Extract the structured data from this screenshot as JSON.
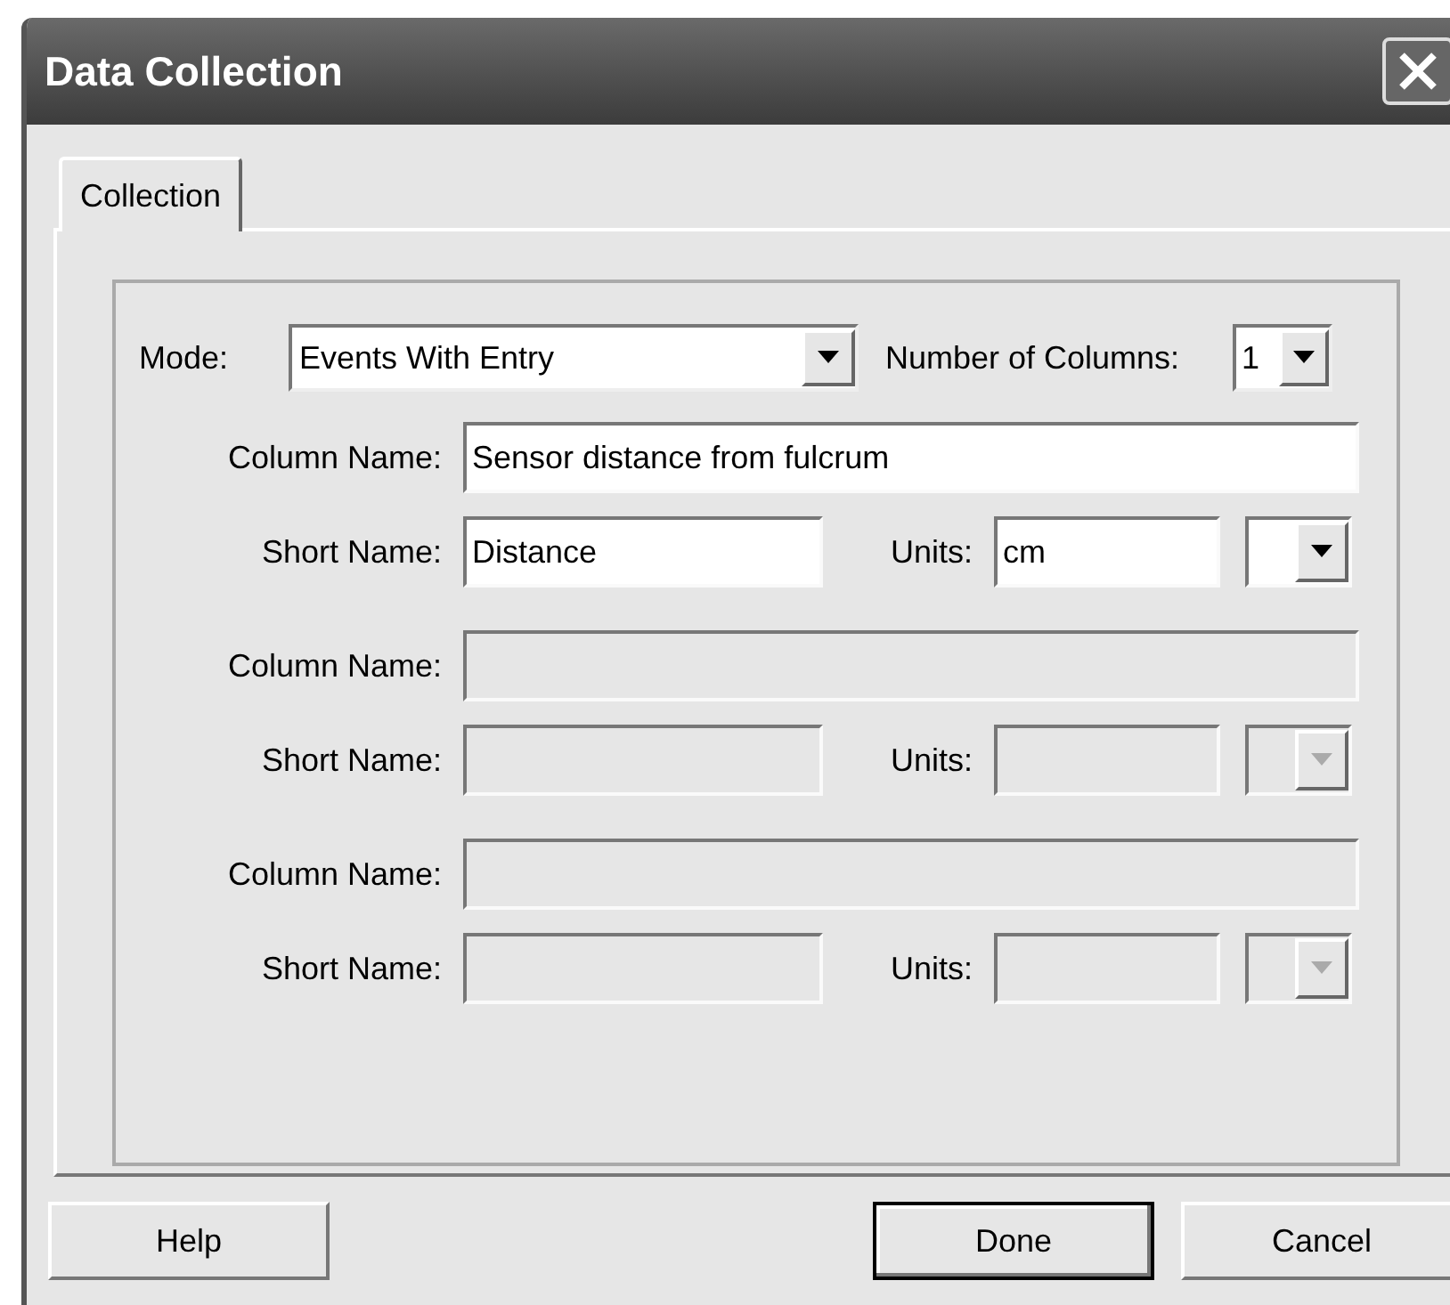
{
  "window": {
    "title": "Data Collection"
  },
  "tabs": [
    {
      "label": "Collection",
      "selected": true
    }
  ],
  "mode": {
    "label": "Mode:",
    "value": "Events With Entry"
  },
  "number_of_columns": {
    "label": "Number of Columns:",
    "value": "1"
  },
  "columns": [
    {
      "disabled": false,
      "column_name_label": "Column Name:",
      "column_name": "Sensor distance from fulcrum",
      "short_name_label": "Short Name:",
      "short_name": "Distance",
      "units_label": "Units:",
      "units": "cm"
    },
    {
      "disabled": true,
      "column_name_label": "Column Name:",
      "short_name_label": "Short Name:",
      "units_label": "Units:"
    },
    {
      "disabled": true,
      "column_name_label": "Column Name:",
      "short_name_label": "Short Name:",
      "units_label": "Units:"
    }
  ],
  "buttons": [
    {
      "label": "Help",
      "default": false
    },
    {
      "label": "Done",
      "default": true
    },
    {
      "label": "Cancel",
      "default": false
    }
  ]
}
